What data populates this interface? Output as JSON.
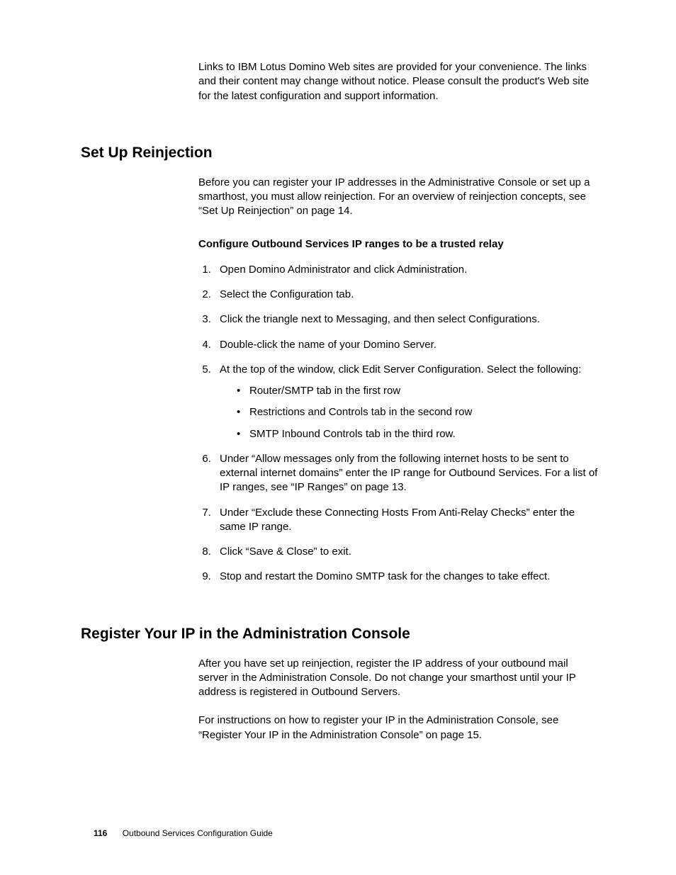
{
  "intro": "Links to IBM Lotus Domino Web sites are provided for your convenience. The links and their content may change without notice. Please consult the product's Web site for the latest configuration and support information.",
  "section1": {
    "title": "Set Up Reinjection",
    "para": "Before you can register your IP addresses in the Administrative Console or set up a smarthost, you must allow reinjection. For an overview of reinjection concepts, see “Set Up Reinjection” on page 14.",
    "subhead": "Configure Outbound Services IP ranges to be a trusted relay",
    "steps": {
      "s1": "Open Domino Administrator and click Administration.",
      "s2": "Select the Configuration tab.",
      "s3": "Click the triangle next to Messaging, and then select Configurations.",
      "s4": "Double-click the name of your Domino Server.",
      "s5": "At the top of the window, click Edit Server Configuration. Select the following:",
      "s5_sub": {
        "a": "Router/SMTP tab in the first row",
        "b": "Restrictions and Controls tab in the second row",
        "c": "SMTP Inbound Controls tab in the third row."
      },
      "s6": "Under “Allow messages only from the following internet hosts to be sent to external internet domains” enter the IP range for Outbound Services. For a list of IP ranges, see “IP Ranges” on page 13.",
      "s7": "Under “Exclude these Connecting Hosts From Anti-Relay Checks” enter the same IP range.",
      "s8": "Click “Save & Close” to exit.",
      "s9": "Stop and restart the Domino SMTP task for the changes to take effect."
    }
  },
  "section2": {
    "title": "Register Your IP in the Administration Console",
    "para1": "After you have set up reinjection, register the IP address of your outbound mail server in the Administration Console. Do not change your smarthost until your IP address is registered in Outbound Servers.",
    "para2": "For instructions on how to register your IP in the Administration Console, see “Register Your IP in the Administration Console” on page 15."
  },
  "footer": {
    "page": "116",
    "title": "Outbound Services Configuration Guide"
  }
}
